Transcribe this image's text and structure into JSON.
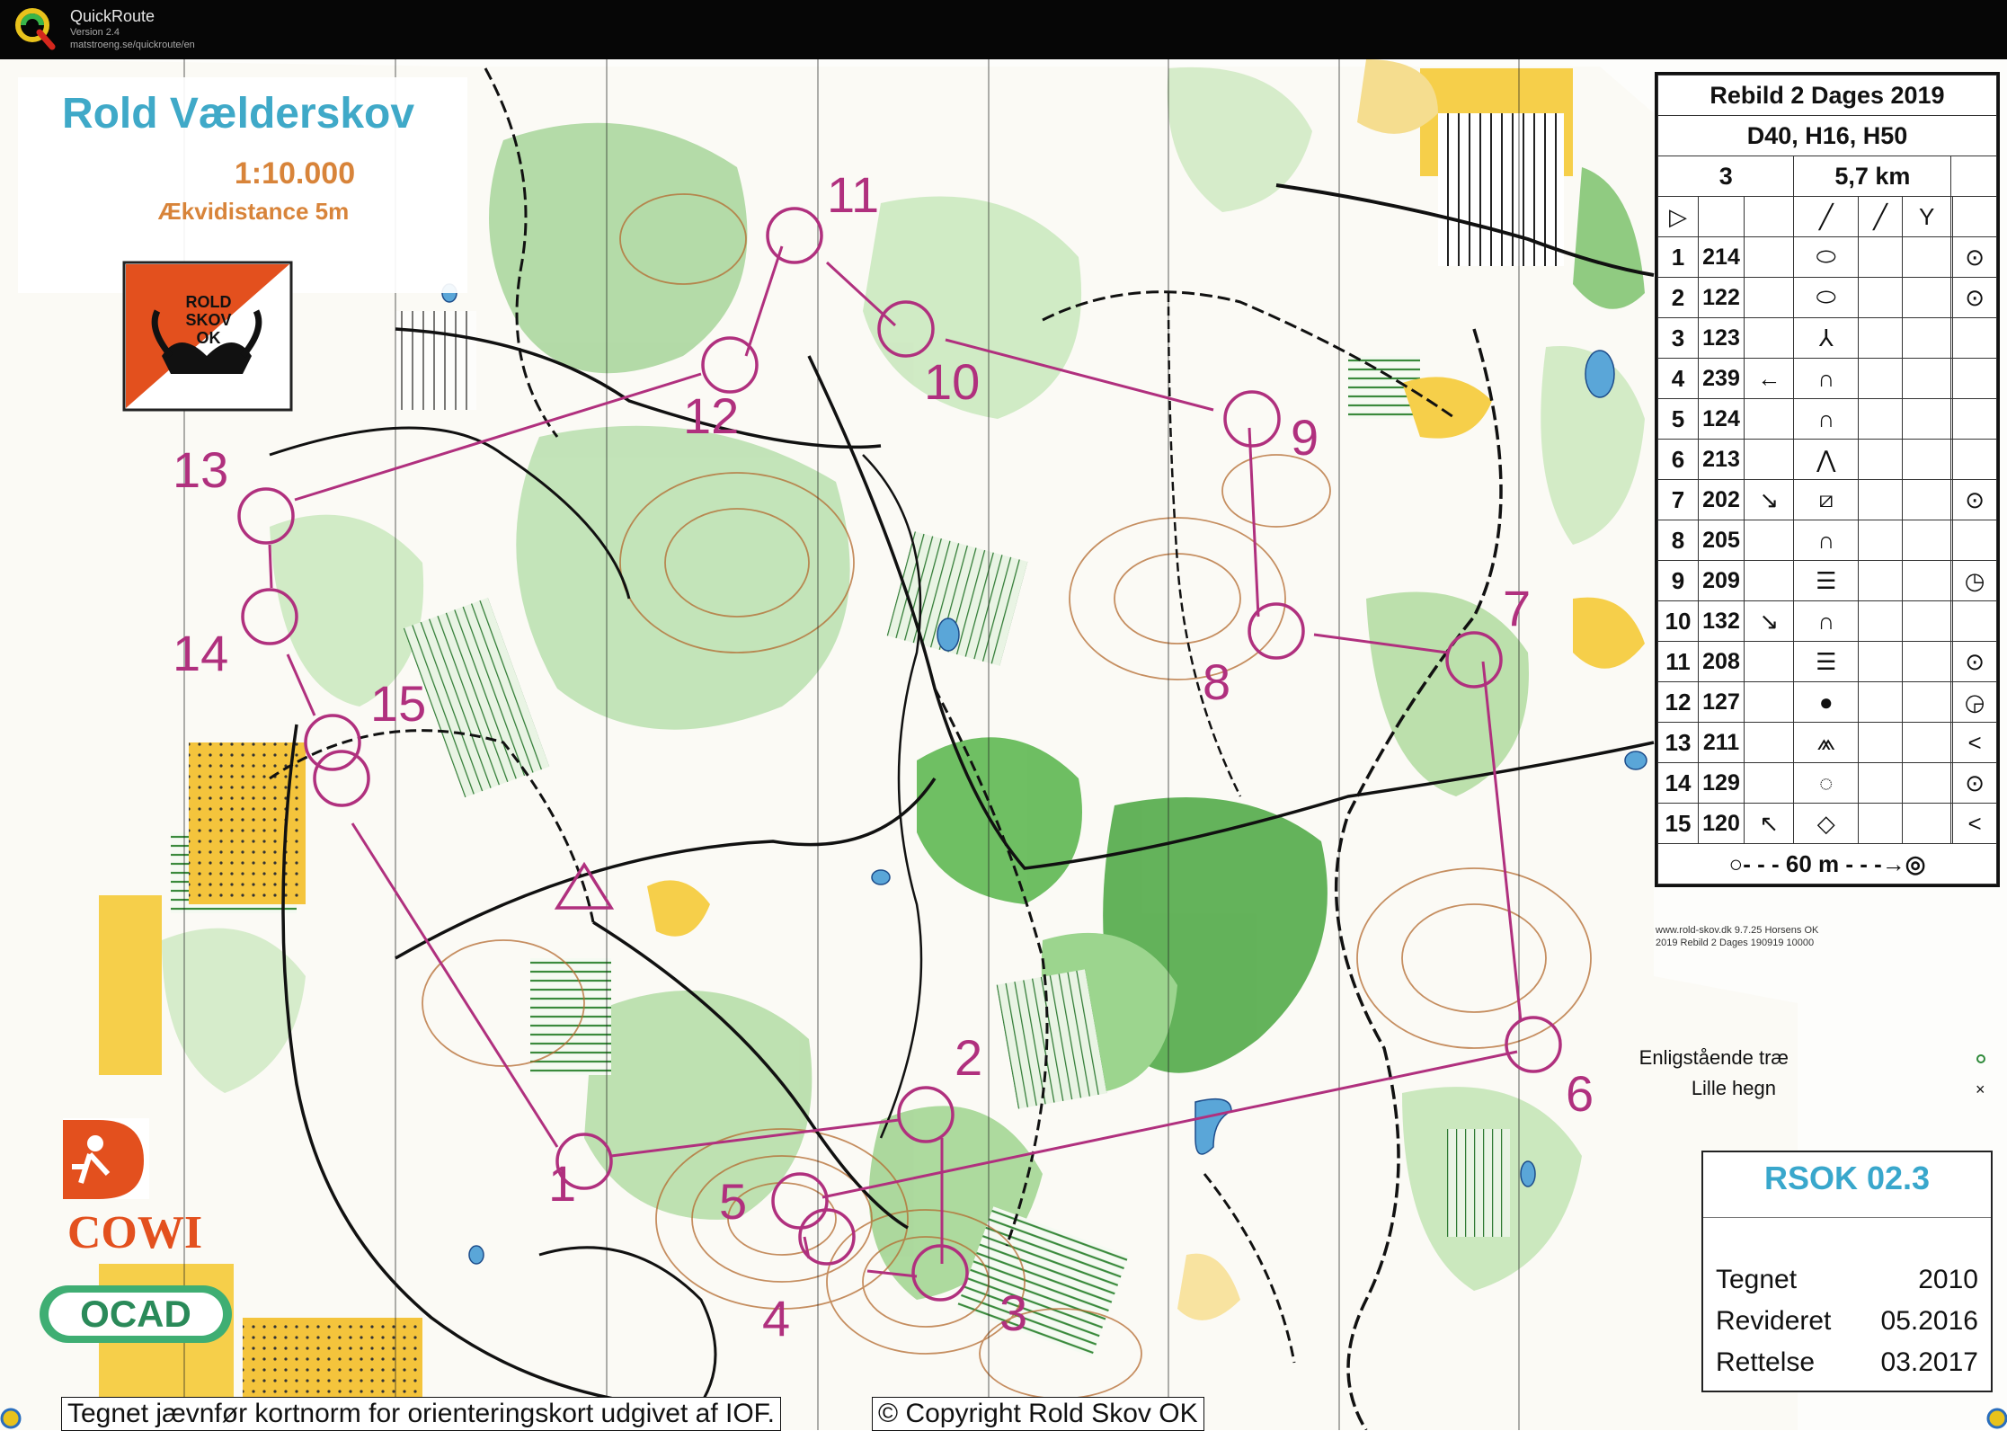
{
  "app": {
    "name": "QuickRoute",
    "version": "Version 2.4",
    "url": "matstroeng.se/quickroute/en"
  },
  "map": {
    "title": "Rold Vælderskov",
    "scale": "1:10.000",
    "contour_interval": "Ækvidistance 5m",
    "club_logo": {
      "line1": "ROLD",
      "line2": "SKOV",
      "line3": "OK"
    },
    "sponsor_cowi": "COWI",
    "sponsor_ocad": "OCAD",
    "course_color": "#b0307e",
    "legend": {
      "single_tree": "Enligstående træ",
      "small_fence": "Lille hegn"
    },
    "small_print_1": "www.rold-skov.dk 9.7.25 Horsens OK",
    "small_print_2": "2019 Rebild 2 Dages 190919 10000",
    "footer_left": "Tegnet jævnfør kortnorm for orienteringskort udgivet af IOF.",
    "footer_right": "© Copyright Rold Skov OK",
    "controls": [
      "1",
      "2",
      "3",
      "4",
      "5",
      "6",
      "7",
      "8",
      "9",
      "10",
      "11",
      "12",
      "13",
      "14",
      "15"
    ]
  },
  "control_description": {
    "event": "Rebild 2 Dages 2019",
    "classes": "D40, H16, H50",
    "course": "3",
    "length": "5,7 km",
    "rows": [
      {
        "n": "1",
        "code": "214",
        "dir": "",
        "feat": "⬭",
        "pos": "⊙"
      },
      {
        "n": "2",
        "code": "122",
        "dir": "",
        "feat": "⬭",
        "pos": "⊙"
      },
      {
        "n": "3",
        "code": "123",
        "dir": "",
        "feat": "⅄",
        "pos": ""
      },
      {
        "n": "4",
        "code": "239",
        "dir": "←",
        "feat": "∩",
        "pos": ""
      },
      {
        "n": "5",
        "code": "124",
        "dir": "",
        "feat": "∩",
        "pos": ""
      },
      {
        "n": "6",
        "code": "213",
        "dir": "",
        "feat": "⋀",
        "pos": ""
      },
      {
        "n": "7",
        "code": "202",
        "dir": "↘",
        "feat": "⧄",
        "pos": "⊙"
      },
      {
        "n": "8",
        "code": "205",
        "dir": "",
        "feat": "∩",
        "pos": ""
      },
      {
        "n": "9",
        "code": "209",
        "dir": "",
        "feat": "☰",
        "pos": "◷"
      },
      {
        "n": "10",
        "code": "132",
        "dir": "↘",
        "feat": "∩",
        "pos": ""
      },
      {
        "n": "11",
        "code": "208",
        "dir": "",
        "feat": "☰",
        "pos": "⊙"
      },
      {
        "n": "12",
        "code": "127",
        "dir": "",
        "feat": "●",
        "pos": "◶"
      },
      {
        "n": "13",
        "code": "211",
        "dir": "",
        "feat": "⩕",
        "pos": "<"
      },
      {
        "n": "14",
        "code": "129",
        "dir": "",
        "feat": "◌",
        "pos": "⊙"
      },
      {
        "n": "15",
        "code": "120",
        "dir": "↖",
        "feat": "◇",
        "pos": "<"
      }
    ],
    "finish": "60 m"
  },
  "info_box": {
    "id": "RSOK 02.3",
    "drawn_label": "Tegnet",
    "drawn_value": "2010",
    "revised_label": "Revideret",
    "revised_value": "05.2016",
    "correction_label": "Rettelse",
    "correction_value": "03.2017"
  }
}
